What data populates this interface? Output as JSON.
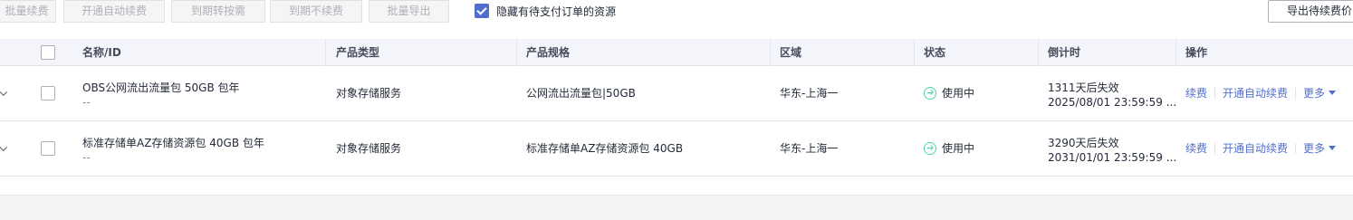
{
  "toolbar": {
    "batch_renew": "批量续费",
    "enable_auto_renew": "开通自动续费",
    "convert_on_expiry": "到期转按需",
    "no_renew_on_expiry": "到期不续费",
    "batch_export": "批量导出",
    "hide_pending_label": "隐藏有待支付订单的资源",
    "export_pending": "导出待续费价"
  },
  "table": {
    "headers": {
      "name": "名称/ID",
      "product_type": "产品类型",
      "spec": "产品规格",
      "region": "区域",
      "status": "状态",
      "countdown": "倒计时",
      "actions": "操作"
    },
    "rows": [
      {
        "name": "OBS公网流出流量包 50GB 包年",
        "id": "--",
        "product_type": "对象存储服务",
        "spec": "公网流出流量包|50GB",
        "region": "华东-上海一",
        "status": "使用中",
        "countdown": "1311天后失效",
        "expire_time": "2025/08/01 23:59:59 ...",
        "action_renew": "续费",
        "action_auto_renew": "开通自动续费",
        "action_more": "更多"
      },
      {
        "name": "标准存储单AZ存储资源包 40GB 包年",
        "id": "--",
        "product_type": "对象存储服务",
        "spec": "标准存储单AZ存储资源包 40GB",
        "region": "华东-上海一",
        "status": "使用中",
        "countdown": "3290天后失效",
        "expire_time": "2031/01/01 23:59:59 ...",
        "action_renew": "续费",
        "action_auto_renew": "开通自动续费",
        "action_more": "更多"
      }
    ]
  },
  "colors": {
    "link": "#526ecc",
    "status_ok": "#50d4ab",
    "header_bg": "#f3f5fb",
    "checkbox_checked": "#526ecc"
  }
}
